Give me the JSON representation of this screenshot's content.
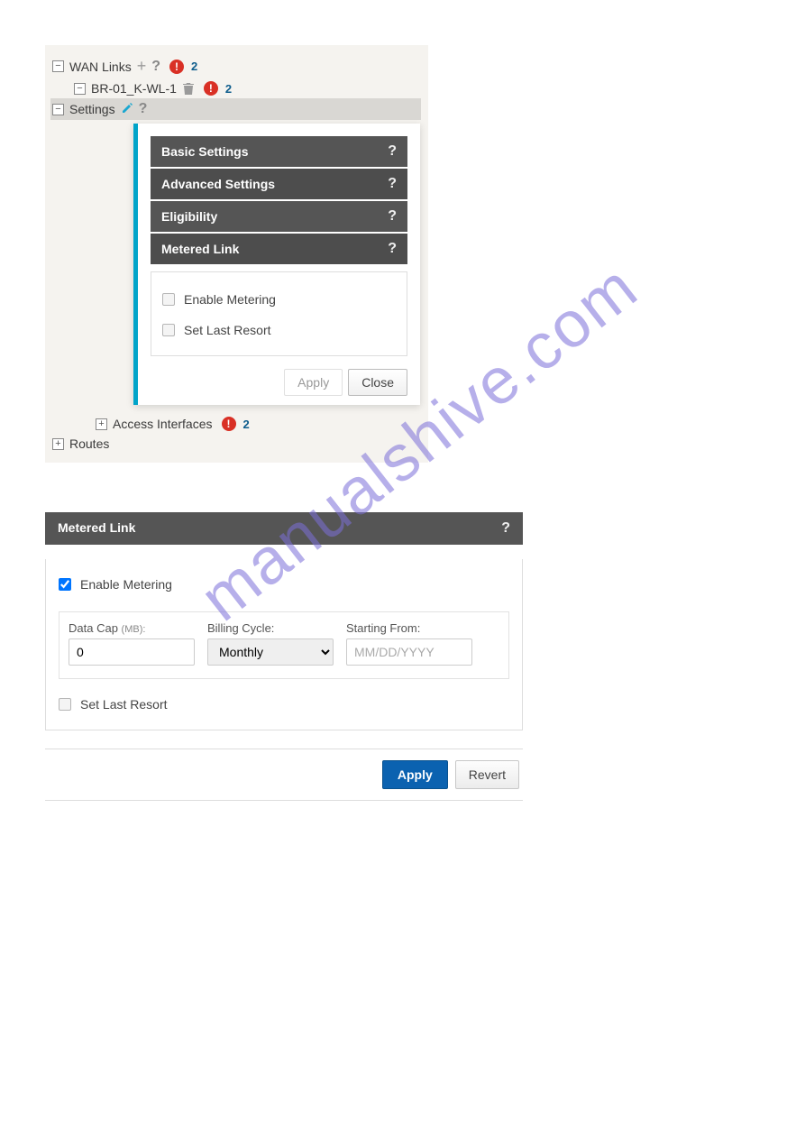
{
  "watermark": "manualshive.com",
  "tree": {
    "wan_links": {
      "label": "WAN Links",
      "alert_count": "2"
    },
    "br_node": {
      "label": "BR-01_K-WL-1",
      "alert_count": "2"
    },
    "settings": {
      "label": "Settings"
    },
    "access_interfaces": {
      "label": "Access Interfaces",
      "alert_count": "2"
    },
    "routes": {
      "label": "Routes"
    }
  },
  "popup": {
    "sections": {
      "basic": "Basic Settings",
      "advanced": "Advanced Settings",
      "eligibility": "Eligibility",
      "metered": "Metered Link"
    },
    "enable_metering": "Enable Metering",
    "set_last_resort": "Set Last Resort",
    "apply": "Apply",
    "close": "Close"
  },
  "panel2": {
    "title": "Metered Link",
    "enable_metering": "Enable Metering",
    "data_cap_label": "Data Cap",
    "data_cap_unit": "(MB):",
    "data_cap_value": "0",
    "billing_label": "Billing Cycle:",
    "billing_value": "Monthly",
    "starting_label": "Starting From:",
    "starting_placeholder": "MM/DD/YYYY",
    "set_last_resort": "Set Last Resort",
    "apply": "Apply",
    "revert": "Revert"
  }
}
